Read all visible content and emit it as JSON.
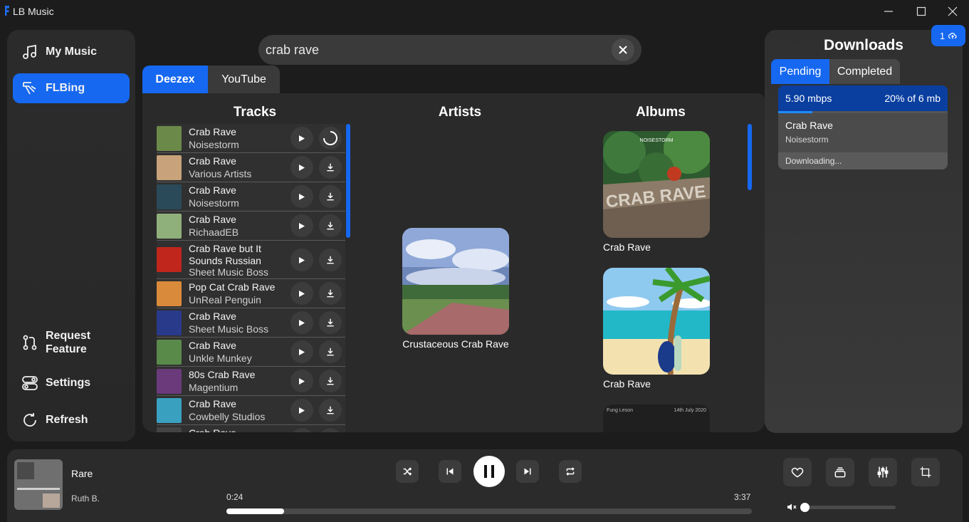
{
  "window": {
    "title": "LB Music"
  },
  "sidebar": {
    "items": [
      {
        "label": "My Music",
        "icon": "music-note-icon",
        "active": false
      },
      {
        "label": "FLBing",
        "icon": "flbing-icon",
        "active": true
      },
      {
        "label": "Request Feature",
        "icon": "pull-request-icon",
        "active": false
      },
      {
        "label": "Settings",
        "icon": "toggle-icon",
        "active": false
      },
      {
        "label": "Refresh",
        "icon": "refresh-icon",
        "active": false
      }
    ]
  },
  "search": {
    "query": "crab rave"
  },
  "sources": {
    "tabs": [
      "Deezex",
      "YouTube"
    ],
    "active": "Deezex"
  },
  "results": {
    "tracks_heading": "Tracks",
    "artists_heading": "Artists",
    "albums_heading": "Albums",
    "tracks": [
      {
        "title": "Crab Rave",
        "artist": "Noisestorm",
        "thumb": "#6b8a4a",
        "downloading": true
      },
      {
        "title": "Crab Rave",
        "artist": "Various Artists",
        "thumb": "#c7a27a"
      },
      {
        "title": "Crab Rave",
        "artist": "Noisestorm",
        "thumb": "#2a4a5a"
      },
      {
        "title": "Crab Rave",
        "artist": "RichaadEB",
        "thumb": "#8fb07a"
      },
      {
        "title": "Crab Rave but It Sounds Russian",
        "artist": "Sheet Music Boss",
        "thumb": "#c0261c"
      },
      {
        "title": "Pop Cat Crab Rave",
        "artist": "UnReal Penguin",
        "thumb": "#d98a3a"
      },
      {
        "title": "Crab Rave",
        "artist": "Sheet Music Boss",
        "thumb": "#2a3a8a"
      },
      {
        "title": "Crab Rave",
        "artist": "Unkle Munkey",
        "thumb": "#5a8a4a"
      },
      {
        "title": "80s Crab Rave",
        "artist": "Magentium",
        "thumb": "#6a3a7a"
      },
      {
        "title": "Crab Rave",
        "artist": "Cowbelly Studios",
        "thumb": "#3aa0c0"
      },
      {
        "title": "Crab Rave",
        "artist": "",
        "thumb": "#444"
      }
    ],
    "artists": [
      {
        "name": "Crustaceous Crab Rave"
      }
    ],
    "albums": [
      {
        "name": "Crab Rave",
        "art_text": "CRAB RAVE",
        "art_label": "NOISESTORM"
      },
      {
        "name": "Crab Rave"
      },
      {
        "name": "",
        "art_left": "Fung Leson",
        "art_right": "14th July 2020"
      }
    ]
  },
  "downloads": {
    "title": "Downloads",
    "badge_count": "1",
    "tabs": [
      "Pending",
      "Completed"
    ],
    "active_tab": "Pending",
    "items": [
      {
        "speed": "5.90 mbps",
        "progress_text": "20% of 6 mb",
        "progress": 0.2,
        "title": "Crab Rave",
        "artist": "Noisestorm",
        "status": "Downloading..."
      }
    ]
  },
  "player": {
    "title": "Rare",
    "artist": "Ruth B.",
    "elapsed": "0:24",
    "duration": "3:37",
    "progress": 0.11,
    "volume": 0.0,
    "playing": true
  },
  "colors": {
    "accent": "#1668f0",
    "panel": "#2b2b2b",
    "background": "#1c1c1c"
  }
}
